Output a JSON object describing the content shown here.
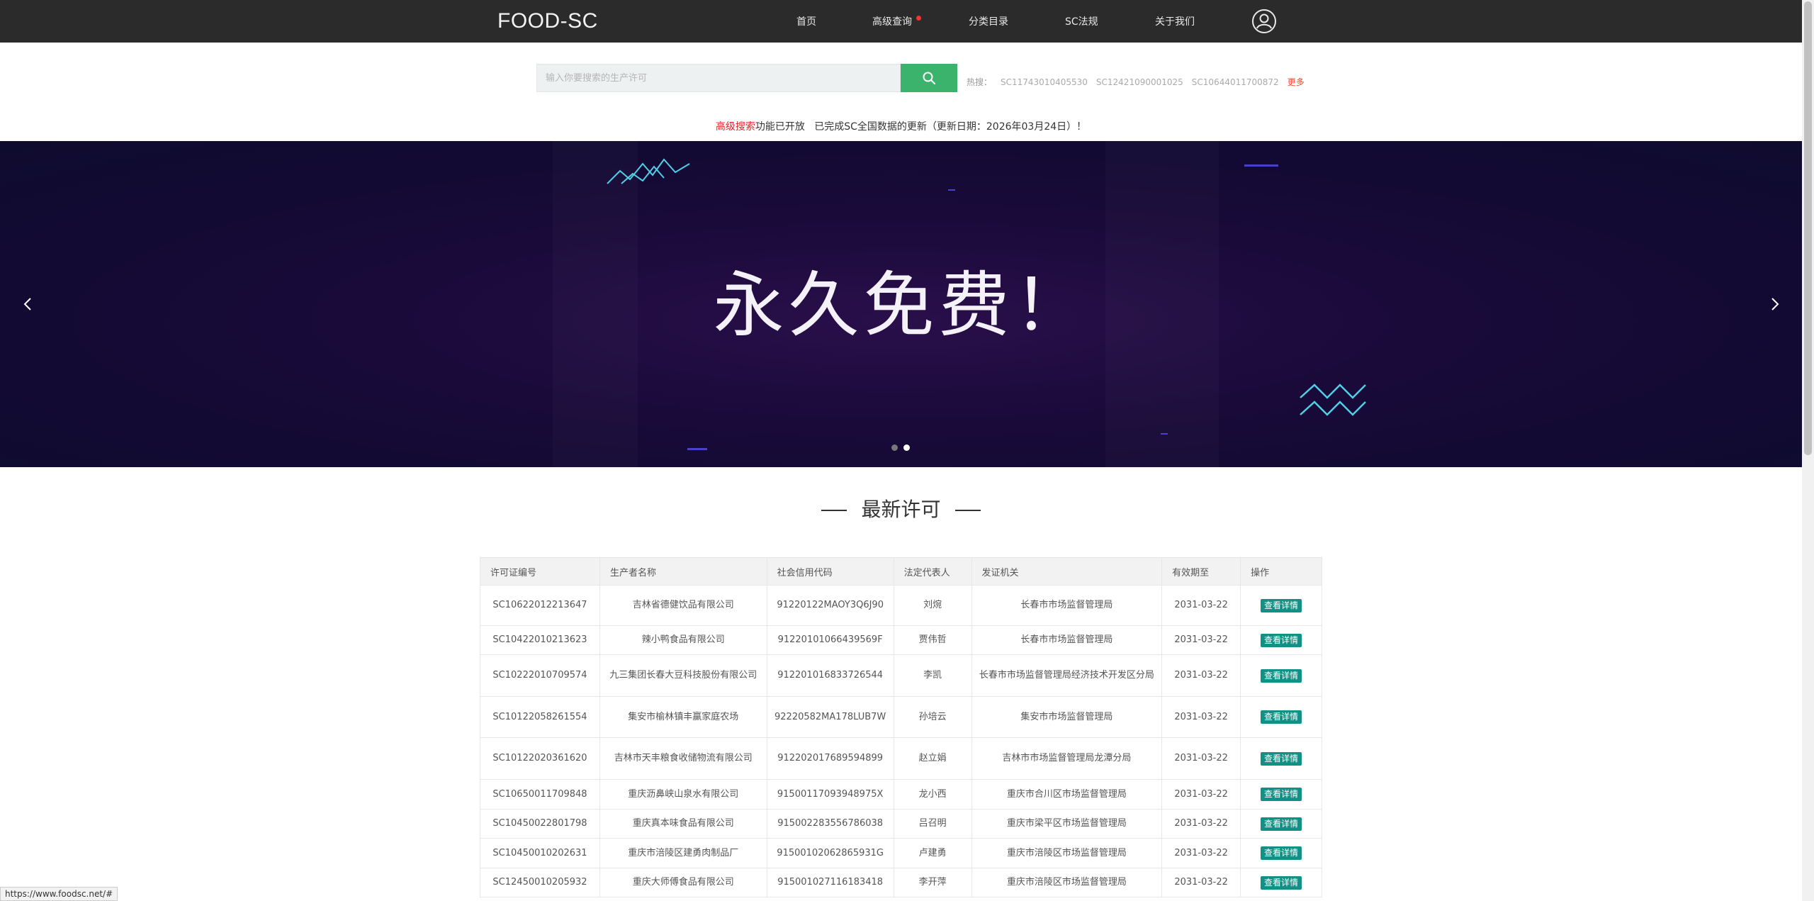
{
  "header": {
    "logo": "FOOD-SC",
    "nav": [
      {
        "label": "首页"
      },
      {
        "label": "高级查询"
      },
      {
        "label": "分类目录"
      },
      {
        "label": "SC法规"
      },
      {
        "label": "关于我们"
      }
    ]
  },
  "search": {
    "placeholder": "输入你要搜索的生产许可",
    "hot_label": "热搜：",
    "hot_items": [
      "SC11743010405530",
      "SC12421090001025",
      "SC10644011700872"
    ],
    "more_label": "更多"
  },
  "notice": {
    "highlight": "高级搜索",
    "text1": "功能已开放",
    "text2": "已完成SC全国数据的更新（更新日期：2026年03月24日）！"
  },
  "banner": {
    "title": "永久免费！"
  },
  "section": {
    "title": "最新许可"
  },
  "table": {
    "headers": [
      "许可证编号",
      "生产者名称",
      "社会信用代码",
      "法定代表人",
      "发证机关",
      "有效期至",
      "操作"
    ],
    "action_label": "查看详情",
    "rows": [
      [
        "SC10622012213647",
        "吉林省德健饮品有限公司",
        "91220122MAOY3Q6J90",
        "刘焥",
        "长春市市场监督管理局",
        "2031-03-22"
      ],
      [
        "SC10422010213623",
        "辣小鸭食品有限公司",
        "91220101066439569F",
        "贾伟哲",
        "长春市市场监督管理局",
        "2031-03-22"
      ],
      [
        "SC10222010709574",
        "九三集团长春大豆科技股份有限公司",
        "912201016833726544",
        "李凯",
        "长春市市场监督管理局经济技术开发区分局",
        "2031-03-22"
      ],
      [
        "SC10122058261554",
        "集安市榆林镇丰赢家庭农场",
        "92220582MA178LUB7W",
        "孙培云",
        "集安市市场监督管理局",
        "2031-03-22"
      ],
      [
        "SC10122020361620",
        "吉林市天丰粮食收储物流有限公司",
        "912202017689594899",
        "赵立娟",
        "吉林市市场监督管理局龙潭分局",
        "2031-03-22"
      ],
      [
        "SC10650011709848",
        "重庆沥鼻峡山泉水有限公司",
        "91500117093948975X",
        "龙小西",
        "重庆市合川区市场监督管理局",
        "2031-03-22"
      ],
      [
        "SC10450022801798",
        "重庆真本味食品有限公司",
        "915002283556786038",
        "吕召明",
        "重庆市梁平区市场监督管理局",
        "2031-03-22"
      ],
      [
        "SC10450010202631",
        "重庆市涪陵区建勇肉制品厂",
        "91500102062865931G",
        "卢建勇",
        "重庆市涪陵区市场监督管理局",
        "2031-03-22"
      ],
      [
        "SC12450010205932",
        "重庆大师傅食品有限公司",
        "915001027116183418",
        "李开萍",
        "重庆市涪陵区市场监督管理局",
        "2031-03-22"
      ]
    ]
  },
  "statusbar": {
    "url": "https://www.foodsc.net/#"
  }
}
